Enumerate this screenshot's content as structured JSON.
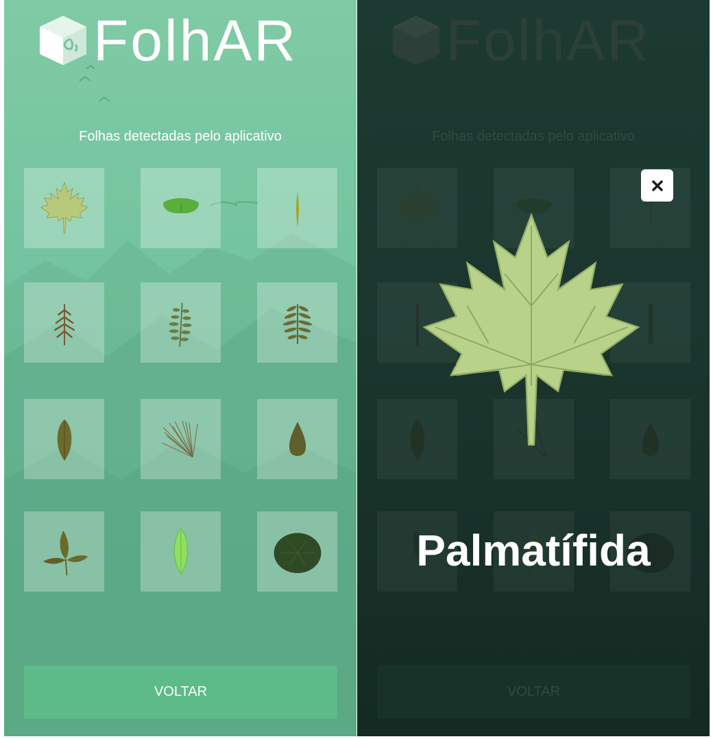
{
  "app": {
    "title": "FolhAR"
  },
  "gallery": {
    "subtitle": "Folhas detectadas pelo aplicativo",
    "leaves": [
      {
        "icon": "maple-leaf-icon"
      },
      {
        "icon": "ginkgo-leaf-icon"
      },
      {
        "icon": "needle-leaf-icon"
      },
      {
        "icon": "cedar-leaf-icon"
      },
      {
        "icon": "fern-leaf-icon"
      },
      {
        "icon": "pinnate-leaf-icon"
      },
      {
        "icon": "oval-leaf-icon"
      },
      {
        "icon": "pine-needles-icon"
      },
      {
        "icon": "teardrop-leaf-icon"
      },
      {
        "icon": "trifoliate-leaf-icon"
      },
      {
        "icon": "lanceolate-leaf-icon"
      },
      {
        "icon": "round-leaf-icon"
      }
    ]
  },
  "back_button": {
    "label": "VOLTAR"
  },
  "detail": {
    "leaf_name": "Palmatífida",
    "leaf_icon": "maple-leaf-icon",
    "close_icon": "close-icon"
  },
  "colors": {
    "primary_bg": "#74c49f",
    "button": "#5dbb89",
    "overlay_dark": "#1a352d",
    "text": "#ffffff"
  }
}
